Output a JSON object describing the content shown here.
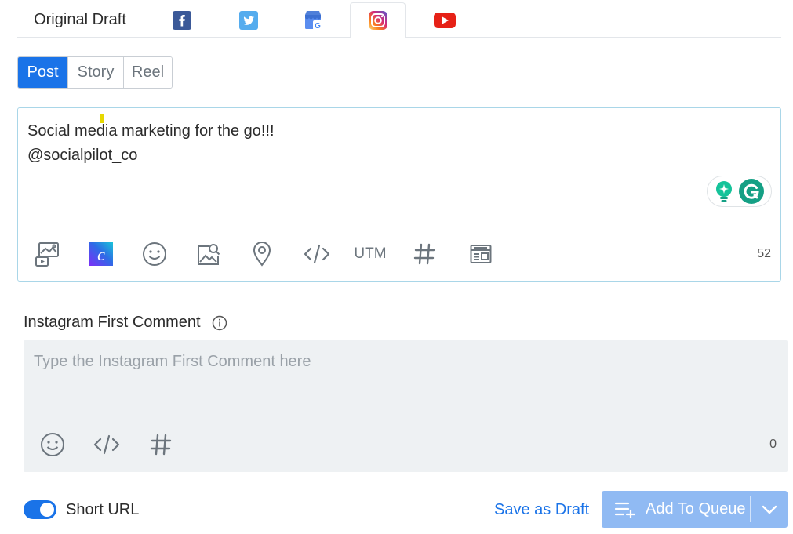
{
  "tabs": {
    "draft_label": "Original Draft",
    "networks": [
      "facebook-icon",
      "twitter-icon",
      "google-business-icon",
      "instagram-icon",
      "youtube-icon"
    ],
    "active": "instagram-icon"
  },
  "post_types": {
    "items": [
      "Post",
      "Story",
      "Reel"
    ],
    "active": "Post"
  },
  "editor": {
    "text": "Social media marketing for the go!!!\n@socialpilot_co",
    "char_count": "52",
    "toolbar_utm": "UTM"
  },
  "first_comment": {
    "label": "Instagram First Comment",
    "placeholder": "Type the Instagram First Comment here",
    "char_count": "0"
  },
  "footer": {
    "short_url_label": "Short URL",
    "short_url_enabled": true,
    "save_draft": "Save as Draft",
    "add_to_queue": "Add To Queue"
  },
  "colors": {
    "primary": "#1a73e8",
    "queue_button": "#90baf3",
    "facebook": "#3b5998",
    "twitter": "#55acee",
    "youtube": "#e62117",
    "grammarly": "#15a085"
  }
}
